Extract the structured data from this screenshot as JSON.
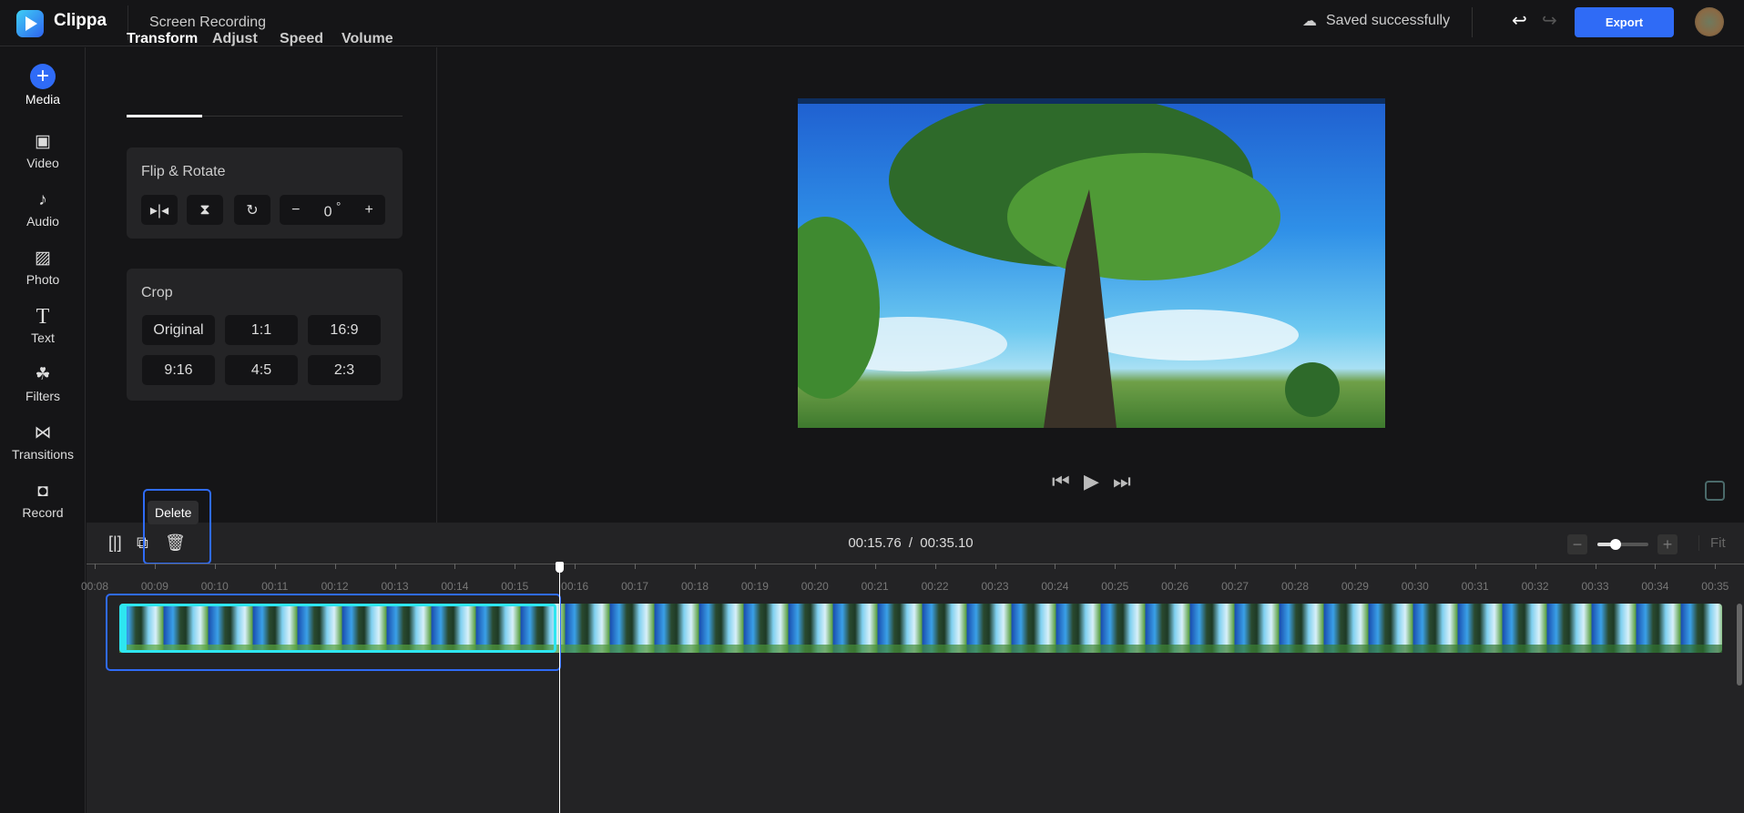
{
  "header": {
    "brand": "Clippa",
    "project_title": "Screen Recording",
    "save_status": "Saved successfully",
    "export_label": "Export",
    "accent": "#2f6bf6"
  },
  "sidebar": {
    "items": [
      {
        "label": "Media",
        "icon": "plus-circle-icon"
      },
      {
        "label": "Video",
        "icon": "video-icon"
      },
      {
        "label": "Audio",
        "icon": "music-icon"
      },
      {
        "label": "Photo",
        "icon": "image-icon"
      },
      {
        "label": "Text",
        "icon": "text-icon"
      },
      {
        "label": "Filters",
        "icon": "filters-icon"
      },
      {
        "label": "Transitions",
        "icon": "transitions-icon"
      },
      {
        "label": "Record",
        "icon": "camera-icon"
      }
    ]
  },
  "panel": {
    "tabs": [
      "Transform",
      "Adjust",
      "Speed",
      "Volume"
    ],
    "active_tab": "Transform",
    "flip_rotate": {
      "title": "Flip & Rotate",
      "rotation_value": "0",
      "degree": "°"
    },
    "crop": {
      "title": "Crop",
      "options": [
        "Original",
        "1:1",
        "16:9",
        "9:16",
        "4:5",
        "2:3"
      ]
    }
  },
  "timeline": {
    "tooltip": "Delete",
    "current_time": "00:15.76",
    "separator": "/",
    "total_time": "00:35.10",
    "fit_label": "Fit",
    "zoom_level": 0.35,
    "ticks": [
      "00:08",
      "00:09",
      "00:10",
      "00:11",
      "00:12",
      "00:13",
      "00:14",
      "00:15",
      "00:16",
      "00:17",
      "00:18",
      "00:19",
      "00:20",
      "00:21",
      "00:22",
      "00:23",
      "00:24",
      "00:25",
      "00:26",
      "00:27",
      "00:28",
      "00:29",
      "00:30",
      "00:31",
      "00:32",
      "00:33",
      "00:34",
      "00:35"
    ]
  }
}
